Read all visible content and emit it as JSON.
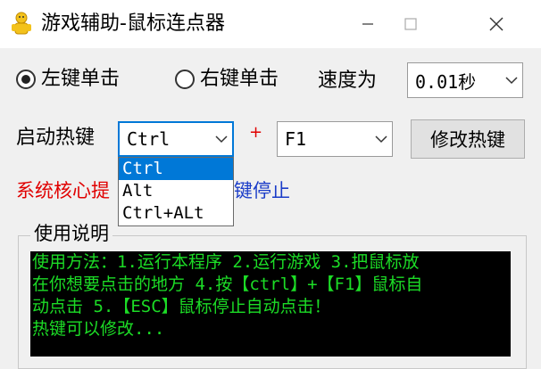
{
  "window": {
    "title": "游戏辅助-鼠标连点器",
    "controls": {
      "minimize_icon": "minimize-icon",
      "maximize_icon": "maximize-icon",
      "close_icon": "close-icon"
    }
  },
  "click_mode": {
    "left_label": "左键单击",
    "right_label": "右键单击",
    "selected": "left"
  },
  "speed": {
    "label": "速度为",
    "value": "0.01秒"
  },
  "hotkey": {
    "label": "启动热键",
    "modifier_value": "Ctrl",
    "plus": "+",
    "key_value": "F1",
    "modify_button": "修改热键",
    "dropdown_options": [
      "Ctrl",
      "Alt",
      "Ctrl+ALt"
    ],
    "dropdown_selected_index": 0
  },
  "status": {
    "red_text": "系统核心提",
    "blue_text": "键停止"
  },
  "instructions": {
    "group_title": "使用说明",
    "lines": [
      "使用方法：1.运行本程序 2.运行游戏 3.把鼠标放",
      "在你想要点击的地方 4.按【ctrl】+【F1】鼠标自",
      "动点击 5.【ESC】鼠标停止自动点击！",
      "热键可以修改..."
    ]
  },
  "colors": {
    "selection": "#0078d7",
    "console_bg": "#000000",
    "console_text": "#1cdc26",
    "status_red": "#e00000",
    "status_blue": "#1a3cc8"
  }
}
